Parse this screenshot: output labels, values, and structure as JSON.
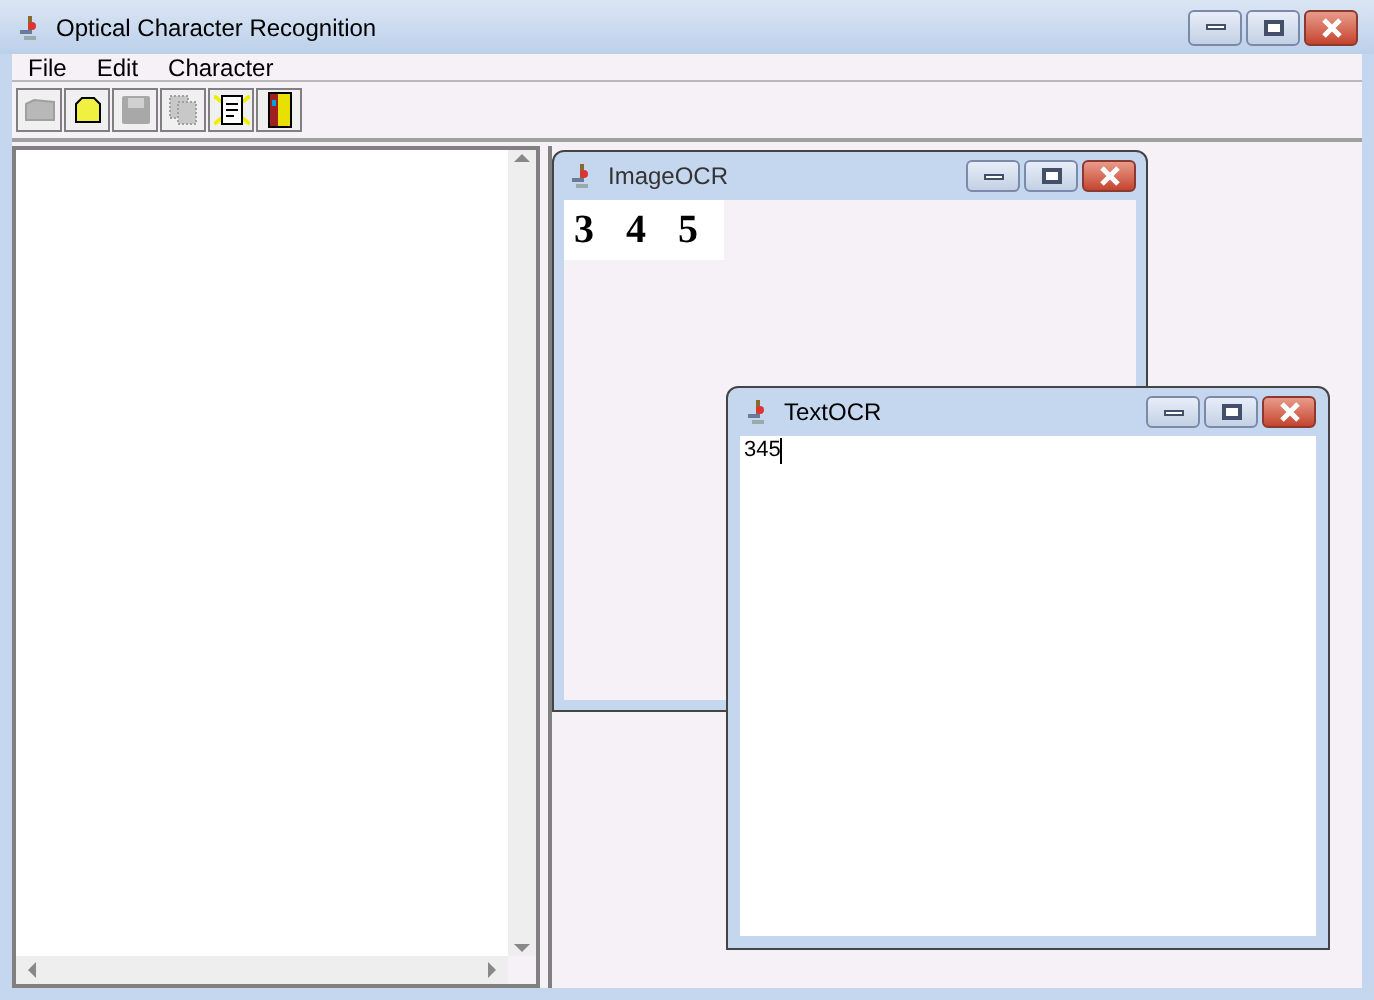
{
  "window": {
    "title": "Optical Character Recognition"
  },
  "menu": [
    "File",
    "Edit",
    "Character"
  ],
  "toolbar": [
    {
      "kind": "open",
      "disabled": true
    },
    {
      "kind": "folder",
      "disabled": false
    },
    {
      "kind": "save",
      "disabled": true
    },
    {
      "kind": "pages",
      "disabled": true
    },
    {
      "kind": "document",
      "disabled": false
    },
    {
      "kind": "exit",
      "disabled": false
    }
  ],
  "image_frame": {
    "title": "ImageOCR",
    "digits": [
      "3",
      "4",
      "5"
    ]
  },
  "text_frame": {
    "title": "TextOCR",
    "value": "345"
  }
}
